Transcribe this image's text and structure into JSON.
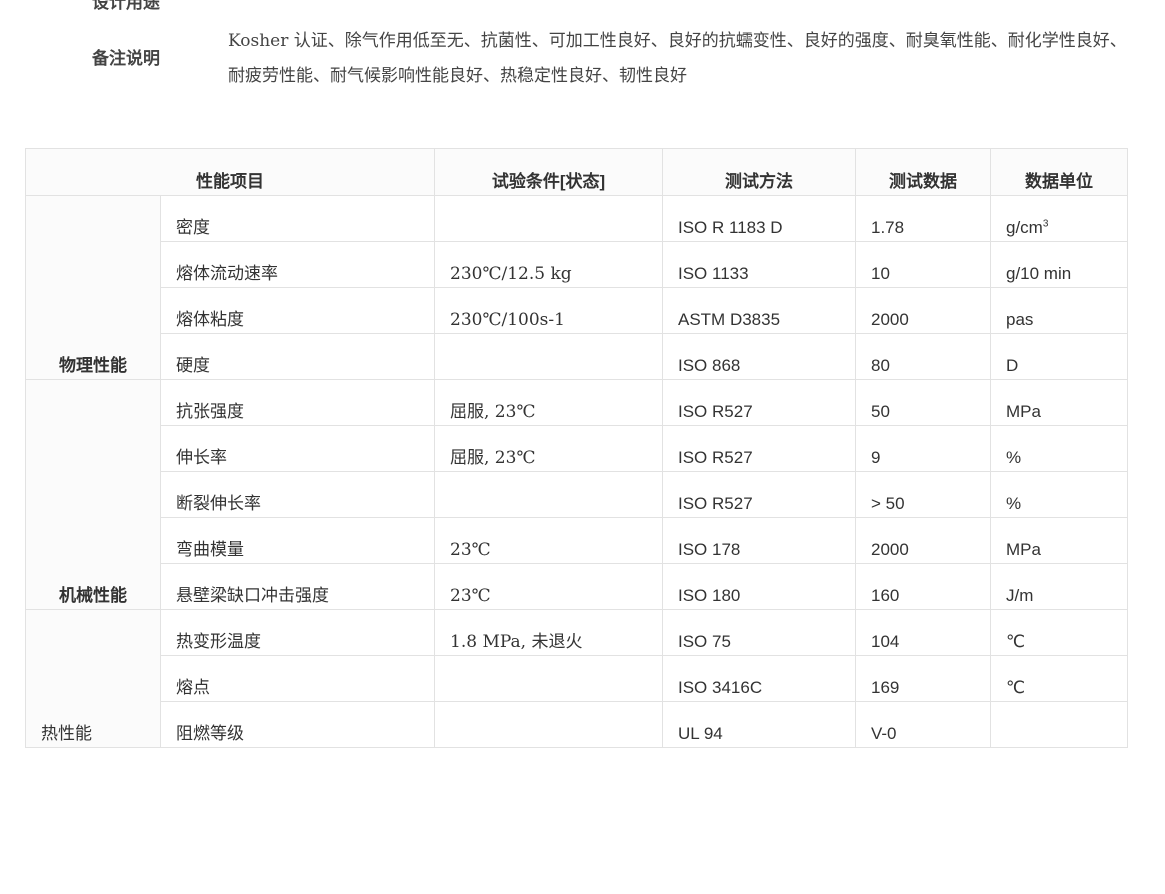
{
  "top_partial_label": "设计用途",
  "note": {
    "label": "备注说明",
    "text": "Kosher 认证、除气作用低至无、抗菌性、可加工性良好、良好的抗蠕变性、良好的强度、耐臭氧性能、耐化学性良好、耐疲劳性能、耐气候影响性能良好、热稳定性良好、韧性良好"
  },
  "table": {
    "headers": [
      "性能项目",
      "试验条件[状态]",
      "测试方法",
      "测试数据",
      "数据单位"
    ],
    "groups": [
      {
        "name": "物理性能",
        "rows": [
          {
            "prop": "密度",
            "cond": "",
            "method": "ISO R 1183 D",
            "value": "1.78",
            "unit": "g/cm",
            "unit_sup": "3"
          },
          {
            "prop": "熔体流动速率",
            "cond": "230℃/12.5 kg",
            "method": "ISO 1133",
            "value": "10",
            "unit": "g/10 min"
          },
          {
            "prop": "熔体粘度",
            "cond": "230℃/100s-1",
            "method": "ASTM D3835",
            "value": "2000",
            "unit": "pas"
          },
          {
            "prop": "硬度",
            "cond": "",
            "method": "ISO 868",
            "value": "80",
            "unit": "D"
          }
        ]
      },
      {
        "name": "机械性能",
        "rows": [
          {
            "prop": "抗张强度",
            "cond": "屈服, 23℃",
            "method": "ISO R527",
            "value": "50",
            "unit": "MPa"
          },
          {
            "prop": "伸长率",
            "cond": "屈服, 23℃",
            "method": "ISO R527",
            "value": "9",
            "unit": "%"
          },
          {
            "prop": "断裂伸长率",
            "cond": "",
            "method": "ISO R527",
            "value": "> 50",
            "unit": "%"
          },
          {
            "prop": "弯曲模量",
            "cond": "23℃",
            "method": "ISO 178",
            "value": "2000",
            "unit": "MPa"
          },
          {
            "prop": "悬壁梁缺口冲击强度",
            "cond": "23℃",
            "method": "ISO 180",
            "value": "160",
            "unit": "J/m"
          }
        ]
      },
      {
        "name": "热性能",
        "rows": [
          {
            "prop": "热变形温度",
            "cond": "1.8 MPa, 未退火",
            "method": "ISO 75",
            "value": "104",
            "unit": "℃"
          },
          {
            "prop": "熔点",
            "cond": "",
            "method": "ISO 3416C",
            "value": "169",
            "unit": "℃"
          },
          {
            "prop": "阻燃等级",
            "cond": "",
            "method": "UL 94",
            "value": "V-0",
            "unit": ""
          }
        ]
      }
    ]
  }
}
